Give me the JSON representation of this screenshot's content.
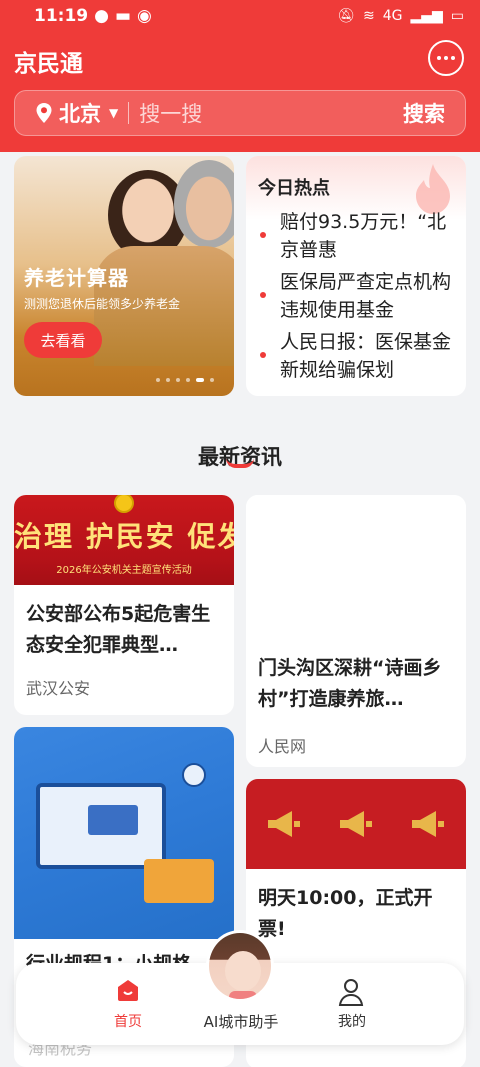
{
  "status_bar": {
    "time": "11:19",
    "network": "4G"
  },
  "header": {
    "app_title": "京民通"
  },
  "search": {
    "city": "北京",
    "placeholder": "搜一搜",
    "button": "搜索"
  },
  "banner": {
    "title": "养老计算器",
    "subtitle": "测测您退休后能领多少养老金",
    "cta": "去看看"
  },
  "hot": {
    "title": "今日热点",
    "items": [
      {
        "text": "赔付93.5万元！“北京普惠"
      },
      {
        "text": "医保局严查定点机构违规使用基金"
      },
      {
        "text": "人民日报：医保基金新规给骗保划"
      }
    ]
  },
  "section": {
    "title": "最新资讯"
  },
  "cards": [
    {
      "image_text": "治理 护民安 促发",
      "image_sub": "2026年公安机关主题宣传活动",
      "title": "公安部公布5起危害生态安全犯罪典型…",
      "source": "武汉公安"
    },
    {
      "title": "门头沟区深耕“诗画乡村”打造康养旅…",
      "source": "人民网"
    },
    {
      "title": "行业规程1：小规格",
      "source": "海南税务"
    },
    {
      "title": "明天10:00，正式开票!",
      "source": ""
    }
  ],
  "tabbar": {
    "home": "首页",
    "ai": "AI城市助手",
    "me": "我的"
  },
  "colors": {
    "accent": "#ef3b39"
  }
}
